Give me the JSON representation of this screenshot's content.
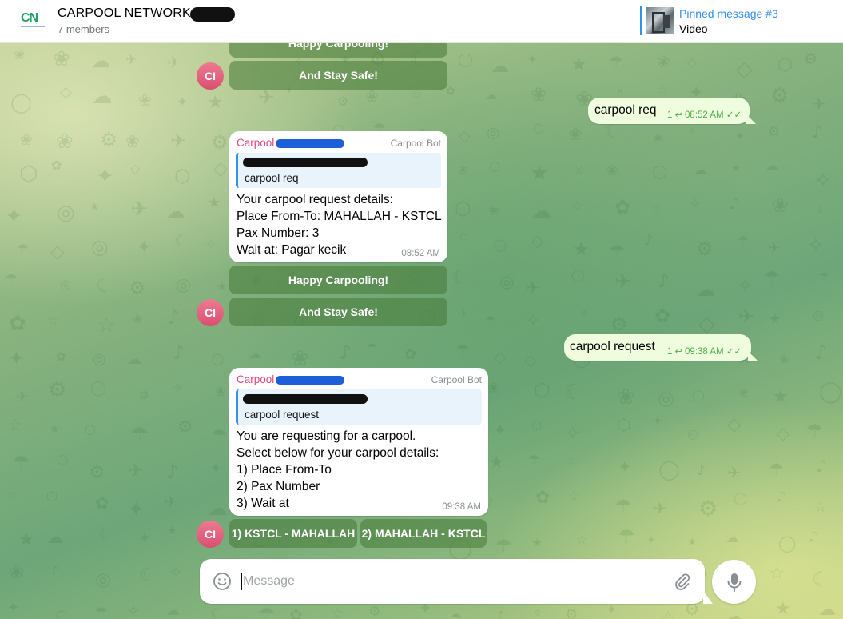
{
  "header": {
    "title": "CARPOOL NETWORK",
    "subtitle": "7 members",
    "logo_text": "CN",
    "pinned": {
      "label": "Pinned message #3",
      "text": "Video"
    }
  },
  "messages": {
    "top_buttons": {
      "row1": "Happy Carpooling!",
      "row2": "And Stay Safe!"
    },
    "out1": {
      "text": "carpool req",
      "replies": "1",
      "time": "08:52 AM"
    },
    "bot1": {
      "sender": "Carpool",
      "role": "Carpool Bot",
      "quote": "carpool req",
      "lines": [
        "Your carpool request details:",
        "Place From-To: MAHALLAH - KSTCL",
        "Pax Number: 3",
        "Wait at: Pagar kecik"
      ],
      "time": "08:52 AM",
      "buttons": [
        "Happy Carpooling!",
        "And Stay Safe!"
      ]
    },
    "out2": {
      "text": "carpool request",
      "replies": "1",
      "time": "09:38 AM"
    },
    "bot2": {
      "sender": "Carpool",
      "role": "Carpool Bot",
      "quote": "carpool request",
      "lines": [
        "You are requesting for a carpool.",
        "Select below for your carpool details:",
        "1) Place From-To",
        "2) Pax Number",
        "3) Wait at"
      ],
      "time": "09:38 AM",
      "buttons": [
        "1) KSTCL - MAHALLAH",
        "2) MAHALLAH - KSTCL"
      ]
    },
    "avatar_initials": "CI"
  },
  "composer": {
    "placeholder": "Message"
  },
  "icons": {
    "emoji": "smile-icon",
    "attach": "paperclip-icon",
    "mic": "microphone-icon",
    "reply": "reply-arrow-icon",
    "read": "double-check-icon"
  },
  "colors": {
    "accent": "#3390ec",
    "sender": "#e0487a",
    "outgoing_bubble": "#effdde",
    "read_check": "#4fae4e"
  }
}
